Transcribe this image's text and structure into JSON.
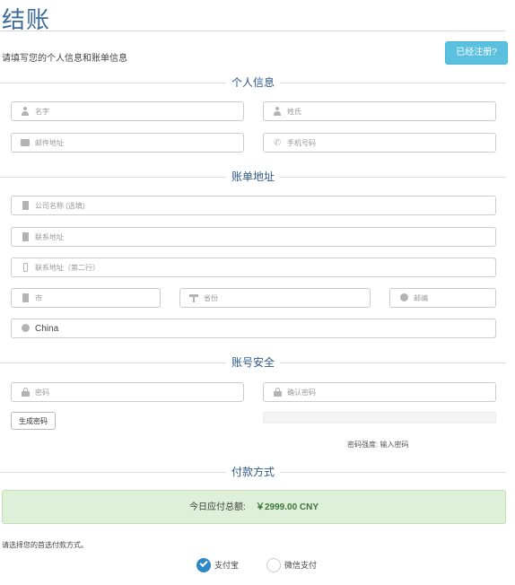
{
  "page": {
    "title": "结账",
    "intro": "请填写您的个人信息和账单信息"
  },
  "header": {
    "registered_button": "已经注册?"
  },
  "sections": {
    "personal": "个人信息",
    "billing": "账单地址",
    "security": "账号安全",
    "payment": "付款方式"
  },
  "personal": {
    "first_name": {
      "placeholder": "名字",
      "icon": "user-icon"
    },
    "last_name": {
      "placeholder": "姓氏",
      "icon": "user-icon"
    },
    "email": {
      "placeholder": "邮件地址",
      "icon": "envelope-icon"
    },
    "phone": {
      "placeholder": "手机号码",
      "icon": "phone-icon"
    }
  },
  "billing": {
    "company": {
      "placeholder": "公司名称 (选填)",
      "icon": "building-icon"
    },
    "address1": {
      "placeholder": "联系地址",
      "icon": "building-icon"
    },
    "address2": {
      "placeholder": "联系地址（第二行）",
      "icon": "mobile-icon"
    },
    "city": {
      "placeholder": "市",
      "icon": "building-icon"
    },
    "state": {
      "placeholder": "省份",
      "icon": "signpost-icon"
    },
    "postcode": {
      "placeholder": "邮编",
      "icon": "location-icon"
    },
    "country": {
      "value": "China",
      "icon": "globe-icon"
    }
  },
  "security": {
    "password": {
      "placeholder": "密码",
      "icon": "lock-icon"
    },
    "confirm_password": {
      "placeholder": "确认密码",
      "icon": "lock-icon"
    },
    "generate_button": "生成密码",
    "strength_text": "密码强度: 输入密码"
  },
  "payment": {
    "total_label": "今日应付总额:",
    "total_amount": "￥2999.00 CNY",
    "instruction": "请选择您的首选付款方式。",
    "methods": [
      {
        "label": "支付宝",
        "selected": true
      },
      {
        "label": "微信支付",
        "selected": false
      }
    ]
  },
  "colors": {
    "title": "#3e6a9a",
    "accent_button": "#5bc0de",
    "total_bg": "#dff0d8",
    "total_text": "#3c763d",
    "radio_selected": "#2e87c9"
  }
}
